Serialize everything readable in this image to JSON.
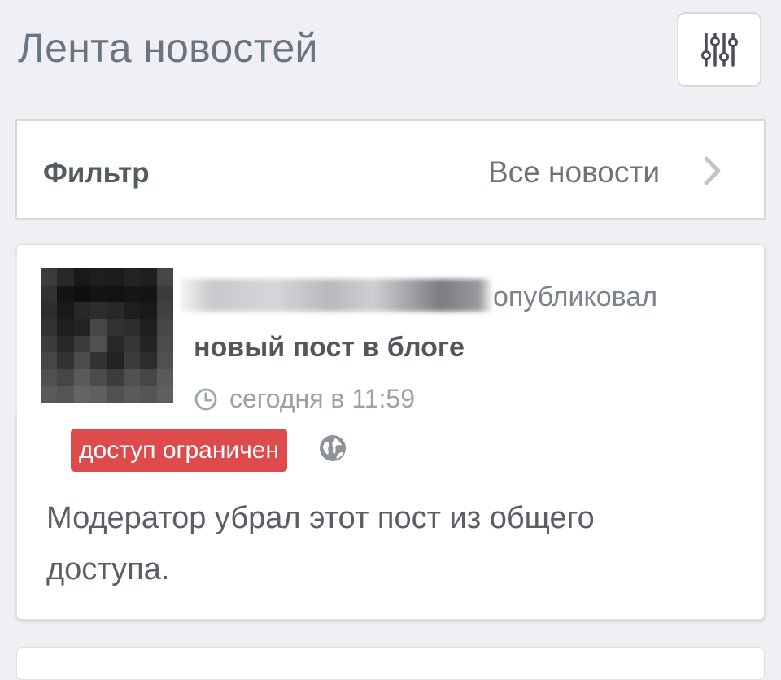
{
  "header": {
    "title": "Лента новостей",
    "settings_icon": "sliders-icon"
  },
  "filter": {
    "label": "Фильтр",
    "value": "Все новости",
    "chevron_icon": "chevron-right-icon"
  },
  "post": {
    "action_text": "опубликовал",
    "object_text": "новый пост в блоге",
    "time_icon": "clock-icon",
    "time_text": "сегодня в 11:59",
    "badge_text": "доступ ограничен",
    "badge_color": "#dd4b4d",
    "visibility_icon": "globe-icon",
    "message": "Модератор убрал этот пост из общего доступа."
  },
  "colors": {
    "background": "#efeff4",
    "title": "#6a7582",
    "card": "#ffffff"
  }
}
